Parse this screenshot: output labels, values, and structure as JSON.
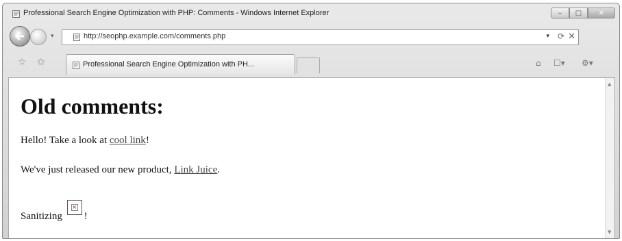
{
  "window": {
    "title": "Professional Search Engine Optimization with PHP: Comments - Windows Internet Explorer",
    "minimize_glyph": "–",
    "maximize_glyph": "□",
    "close_glyph": "✕"
  },
  "nav": {
    "url": "http://seophp.example.com/comments.php",
    "dropdown_glyph": "▾",
    "refresh_glyph": "⟳",
    "stop_glyph": "✕"
  },
  "tabs": [
    {
      "label": "Professional Search Engine Optimization with PH..."
    }
  ],
  "toolbar": {
    "favorites_glyph": "☆",
    "add_favorites_glyph": "✩",
    "home_glyph": "⌂",
    "page_glyph": "☐▾",
    "tools_glyph": "⚙▾"
  },
  "page": {
    "heading": "Old comments:",
    "comment1": {
      "text_before": "Hello! Take a look at ",
      "link": "cool link",
      "text_after": "!"
    },
    "comment2": {
      "text_before": "We've just released our new product, ",
      "link": "Link Juice",
      "text_after": "."
    },
    "comment3": {
      "text_before": "Sanitizing ",
      "img_glyph": "×",
      "text_after": "!"
    }
  },
  "scrollbar": {
    "up_glyph": "▲",
    "down_glyph": "▼"
  }
}
